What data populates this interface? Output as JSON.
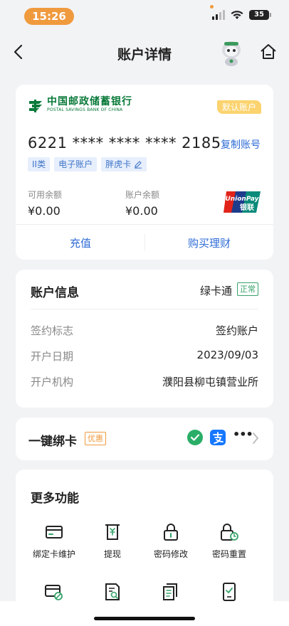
{
  "status_bar": {
    "time": "15:26",
    "battery": "35"
  },
  "nav": {
    "title": "账户详情"
  },
  "bank_card": {
    "bank_name": "中国邮政储蓄银行",
    "bank_name_en": "POSTAL SAVINGS BANK OF CHINA",
    "default_badge": "默认账户",
    "card_number": "6221 **** **** **** 2185",
    "copy_label": "复制账号",
    "tags": [
      "II类",
      "电子账户",
      "胖虎卡"
    ],
    "available_label": "可用余额",
    "available_value": "¥0.00",
    "balance_label": "账户余额",
    "balance_value": "¥0.00",
    "unionpay_en": "UnionPay",
    "unionpay_cn": "银联",
    "recharge_label": "充值",
    "buy_label": "购买理财"
  },
  "account_info": {
    "title": "账户信息",
    "green_link": "绿卡通",
    "status": "正常",
    "rows": [
      {
        "label": "签约标志",
        "value": "签约账户"
      },
      {
        "label": "开户日期",
        "value": "2023/09/03"
      },
      {
        "label": "开户机构",
        "value": "濮阳县柳屯镇营业所"
      }
    ]
  },
  "bind": {
    "title": "一键绑卡",
    "promo": "优惠",
    "more": "•••"
  },
  "more_functions": {
    "title": "更多功能",
    "items": [
      {
        "label": "绑定卡维护",
        "icon": "card-icon"
      },
      {
        "label": "提现",
        "icon": "withdraw-icon"
      },
      {
        "label": "密码修改",
        "icon": "lock-icon"
      },
      {
        "label": "密码重置",
        "icon": "lock-reset-icon"
      },
      {
        "label": "",
        "icon": "card-cancel-icon"
      },
      {
        "label": "",
        "icon": "document-search-icon"
      },
      {
        "label": "",
        "icon": "documents-icon"
      },
      {
        "label": "",
        "icon": "phone-doc-icon"
      }
    ]
  },
  "colors": {
    "brand_green": "#0a7a3a",
    "link_blue": "#2e6bd6",
    "accent_orange": "#f09a3e",
    "status_green": "#35a36a"
  }
}
